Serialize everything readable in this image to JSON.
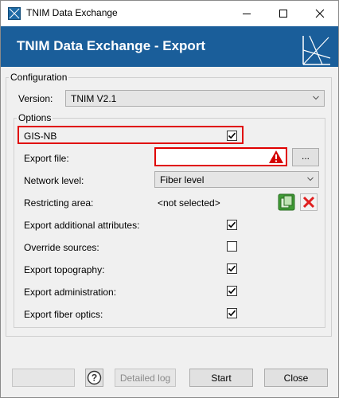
{
  "window": {
    "title": "TNIM Data Exchange"
  },
  "header": {
    "title": "TNIM Data Exchange - Export"
  },
  "configuration": {
    "group_label": "Configuration",
    "version_label": "Version:",
    "version_value": "TNIM V2.1"
  },
  "options": {
    "group_label": "Options",
    "gis_nb_label": "GIS-NB",
    "gis_nb_checked": true,
    "export_file_label": "Export file:",
    "export_file_value": "",
    "browse_label": "...",
    "network_level_label": "Network level:",
    "network_level_value": "Fiber level",
    "restricting_area_label": "Restricting area:",
    "restricting_area_value": "<not selected>",
    "checks": [
      {
        "label": "Export additional attributes:",
        "checked": true
      },
      {
        "label": "Override sources:",
        "checked": false
      },
      {
        "label": "Export topography:",
        "checked": true
      },
      {
        "label": "Export administration:",
        "checked": true
      },
      {
        "label": "Export fiber optics:",
        "checked": true
      }
    ]
  },
  "footer": {
    "detailed_log_label": "Detailed log",
    "start_label": "Start",
    "close_label": "Close"
  },
  "colors": {
    "header_bg": "#1a5e9a",
    "error_red": "#e00000"
  }
}
